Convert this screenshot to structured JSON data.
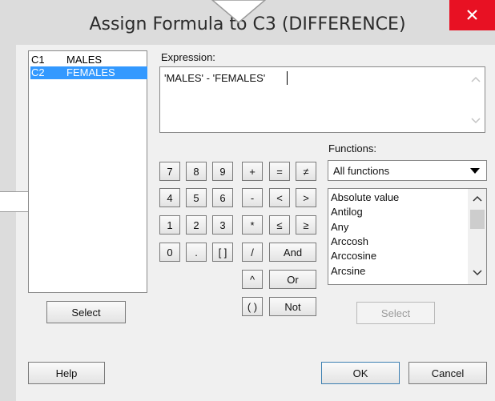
{
  "dialog": {
    "title": "Assign Formula to C3 (DIFFERENCE)",
    "close_glyph": "✕"
  },
  "variables": [
    {
      "col": "C1",
      "name": "MALES",
      "selected": false
    },
    {
      "col": "C2",
      "name": "FEMALES",
      "selected": true
    }
  ],
  "variables_select_label": "Select",
  "expression": {
    "label": "Expression:",
    "value": "'MALES' - 'FEMALES'"
  },
  "keypad": {
    "row1": [
      "7",
      "8",
      "9",
      "+",
      "=",
      "≠"
    ],
    "row2": [
      "4",
      "5",
      "6",
      "-",
      "<",
      ">"
    ],
    "row3": [
      "1",
      "2",
      "3",
      "*",
      "≤",
      "≥"
    ],
    "row4": [
      "0",
      ".",
      "[ ]",
      "/",
      "And"
    ],
    "row5": [
      "^",
      "Or"
    ],
    "row6": [
      "( )",
      "Not"
    ]
  },
  "functions": {
    "label": "Functions:",
    "filter_value": "All functions",
    "items": [
      "Absolute value",
      "Antilog",
      "Any",
      "Arccosh",
      "Arccosine",
      "Arcsine"
    ],
    "select_label": "Select"
  },
  "footer": {
    "help_label": "Help",
    "ok_label": "OK",
    "cancel_label": "Cancel"
  },
  "colors": {
    "selection": "#3399ff",
    "close_button": "#e81123"
  }
}
